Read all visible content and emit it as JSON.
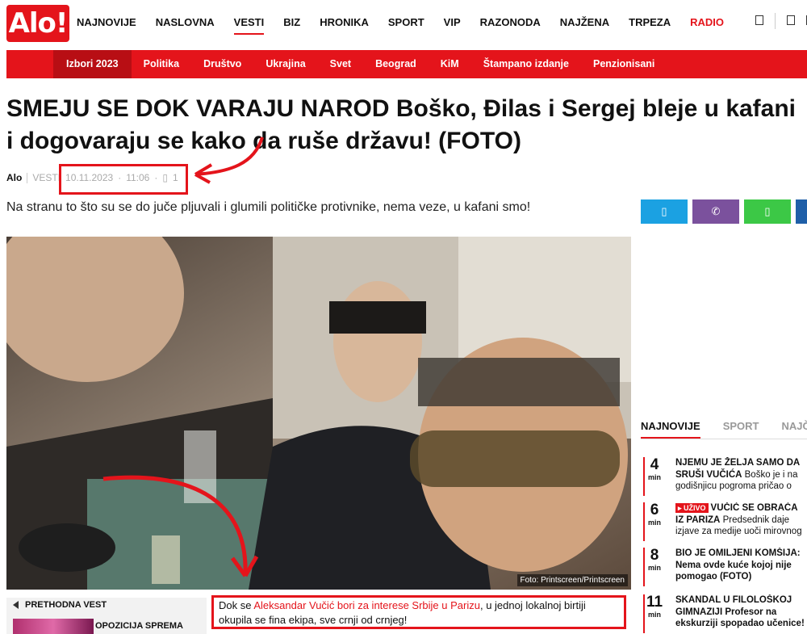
{
  "logo": "Alo!",
  "nav": {
    "items": [
      "NAJNOVIJE",
      "NASLOVNA",
      "VESTI",
      "BIZ",
      "HRONIKA",
      "SPORT",
      "VIP",
      "RAZONODA",
      "NAJŽENA",
      "TRPEZA",
      "RADIO"
    ],
    "active": "VESTI"
  },
  "subnav": [
    "Izbori 2023",
    "Politika",
    "Društvo",
    "Ukrajina",
    "Svet",
    "Beograd",
    "KiM",
    "Štampano izdanje",
    "Penzionisani"
  ],
  "article": {
    "title": "SMEJU SE DOK VARAJU NAROD Boško, Đilas i Sergej bleje u kafani i dogovaraju se kako da ruše državu! (FOTO)",
    "author": "Alo",
    "section": "VESTI",
    "date": "10.11.2023",
    "time": "11:06",
    "comments": "1",
    "lead": "Na stranu to što su se do juče pljuvali i glumili političke protivnike, nema veze, u kafani smo!",
    "photo_credit": "Foto: Printscreen/Printscreen",
    "caption_before": "Dok se ",
    "caption_link": "Aleksandar Vučić bori za interese Srbije u Parizu",
    "caption_after": ", u jednoj lokalnoj birtiji okupila se fina ekipa, sve crnji od crnjeg!"
  },
  "prev": {
    "label": "PRETHODNA VEST",
    "title": "OPOZICIJA SPREMA"
  },
  "share": {
    "icons": [
      "twitter-icon",
      "viber-icon",
      "whatsapp-icon",
      "facebook-icon"
    ]
  },
  "sidebar": {
    "tabs": [
      "NAJNOVIJE",
      "SPORT",
      "NAJČ"
    ],
    "news": [
      {
        "num": "4",
        "unit": "min",
        "title": "NJEMU JE ŽELJA SAMO DA SRUŠI VUČIĆA",
        "rest": " Boško je i na godišnjicu pogroma pričao o",
        "live": ""
      },
      {
        "num": "6",
        "unit": "min",
        "title": "VUČIĆ SE OBRAĆA IZ PARIZA",
        "rest": " Predsednik daje izjave za medije uoči mirovnog",
        "live": "UŽIVO"
      },
      {
        "num": "8",
        "unit": "min",
        "title": "BIO JE OMILJENI KOMŠIJA: Nema ovde kuće kojoj nije pomogao (FOTO)",
        "rest": "",
        "live": ""
      },
      {
        "num": "11",
        "unit": "min",
        "title": "SKANDAL U FILOLOŠKOJ GIMNAZIJI Profesor na ekskurziji spopadao učenice!",
        "rest": "",
        "live": ""
      }
    ]
  },
  "colors": {
    "accent": "#e4141b",
    "dark_red": "#b80e14"
  }
}
